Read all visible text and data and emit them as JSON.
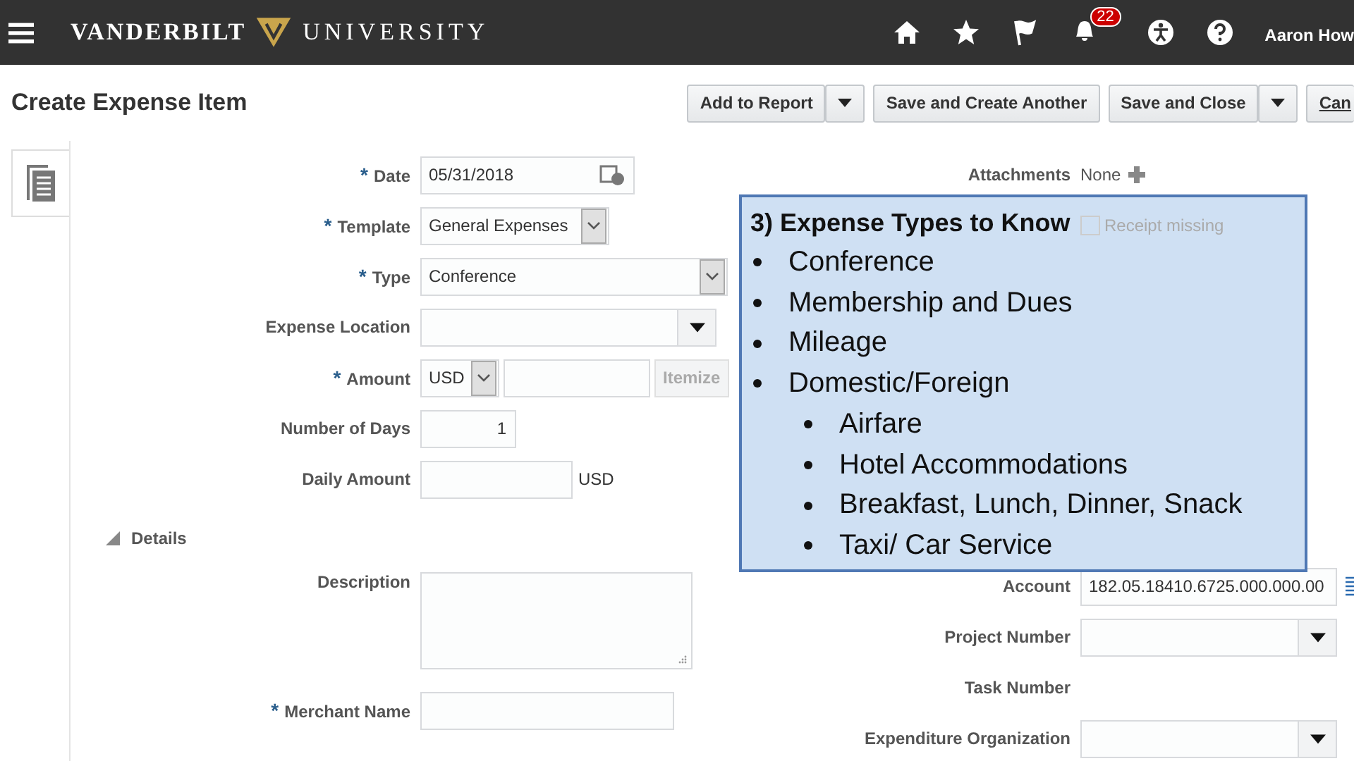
{
  "header": {
    "brand_left": "VANDERBILT",
    "brand_right": "UNIVERSITY",
    "notification_count": "22",
    "user": "Aaron How"
  },
  "page": {
    "title": "Create Expense Item",
    "buttons": [
      {
        "label": "Add to Report",
        "kind": "split"
      },
      {
        "label": "Save and Create Another",
        "kind": "plain"
      },
      {
        "label": "Save and Close",
        "kind": "split"
      },
      {
        "label": "Can",
        "kind": "plain"
      }
    ]
  },
  "left_fields": [
    {
      "required_mark": "*",
      "label": "Date",
      "kind": "date",
      "value": "05/31/2018"
    },
    {
      "required_mark": "*",
      "label": "Template",
      "kind": "choice",
      "value": "General Expenses"
    },
    {
      "required_mark": "*",
      "label": "Type",
      "kind": "choice",
      "value": "Conference"
    },
    {
      "label": "Expense Location",
      "kind": "list"
    },
    {
      "required_mark": "*",
      "label": "Amount",
      "kind": "currency",
      "value": "USD",
      "action": {
        "label": "Itemize",
        "disabled": true
      }
    },
    {
      "label": "Number of Days",
      "kind": "number",
      "value": "1"
    },
    {
      "label": "Daily Amount",
      "kind": "unit",
      "unit": "USD"
    }
  ],
  "details": {
    "label": "Details",
    "expanded": true,
    "fields": [
      {
        "label": "Description",
        "kind": "textarea"
      },
      {
        "required_mark": "*",
        "label": "Merchant Name",
        "kind": "text"
      }
    ]
  },
  "attachments": {
    "label": "Attachments",
    "value": "None"
  },
  "receipt_missing": {
    "label": "Receipt missing",
    "checked": false,
    "disabled": true
  },
  "right_fields": [
    {
      "label": "Account",
      "kind": "account",
      "value": "182.05.18410.6725.000.000.00"
    },
    {
      "label": "Project Number",
      "kind": "list"
    },
    {
      "label": "Task Number",
      "kind": "none"
    },
    {
      "label": "Expenditure Organization",
      "kind": "list"
    }
  ],
  "callout": {
    "title": "3) Expense Types to Know",
    "items": [
      {
        "text": "Conference"
      },
      {
        "text": "Membership and Dues"
      },
      {
        "text": "Mileage"
      },
      {
        "text": "Domestic/Foreign",
        "children": [
          {
            "text": "Airfare"
          },
          {
            "text": "Hotel Accommodations"
          },
          {
            "text": "Breakfast, Lunch, Dinner, Snack"
          },
          {
            "text": "Taxi/ Car Service"
          }
        ]
      }
    ]
  }
}
